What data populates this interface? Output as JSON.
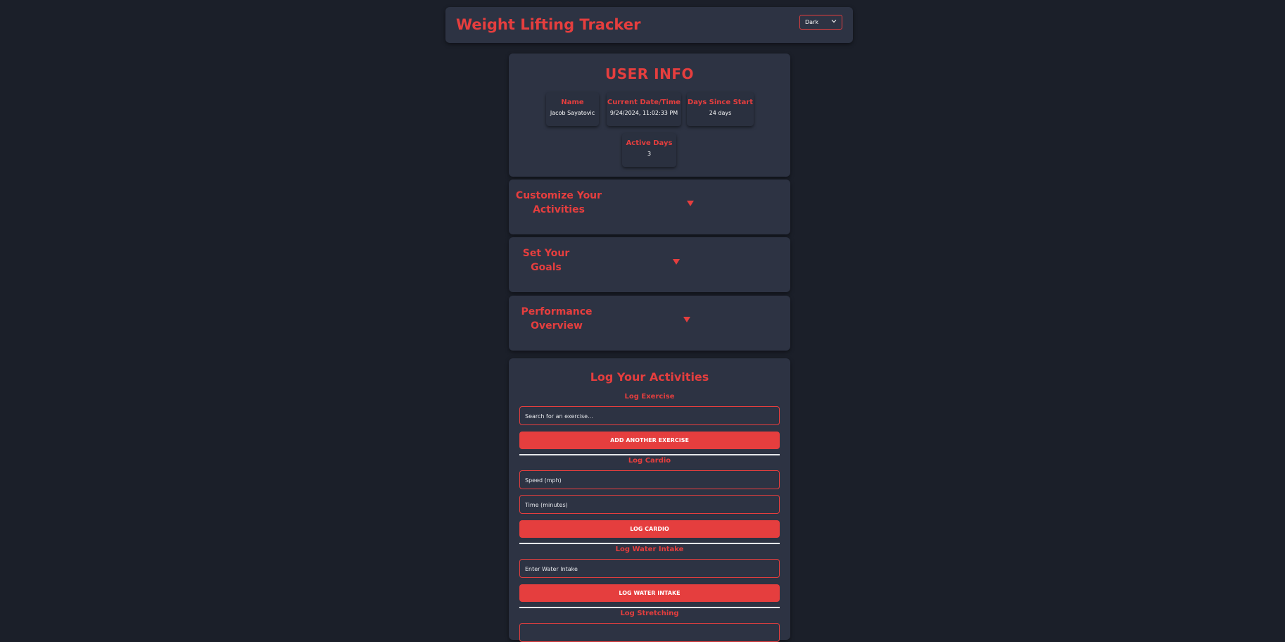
{
  "header": {
    "title": "Weight Lifting Tracker",
    "theme_selected": "Dark"
  },
  "user_info": {
    "heading": "USER INFO",
    "stats": [
      {
        "label": "Name",
        "value": "Jacob Sayatovic"
      },
      {
        "label": "Current Date/Time",
        "value": "9/24/2024, 11:02:33 PM"
      },
      {
        "label": "Days Since Start",
        "value": "24 days"
      },
      {
        "label": "Active Days",
        "value": "3"
      }
    ]
  },
  "sections": [
    {
      "title_line1": "Customize Your",
      "title_line2": "Activities"
    },
    {
      "title_line1": "Set Your",
      "title_line2": "Goals"
    },
    {
      "title_line1": "Performance",
      "title_line2": "Overview"
    }
  ],
  "log": {
    "heading": "Log Your Activities",
    "exercise": {
      "label": "Log Exercise",
      "search_placeholder": "Search for an exercise...",
      "button": "ADD ANOTHER EXERCISE"
    },
    "cardio": {
      "label": "Log Cardio",
      "speed_placeholder": "Speed (mph)",
      "time_placeholder": "Time (minutes)",
      "button": "LOG CARDIO"
    },
    "water": {
      "label": "Log Water Intake",
      "placeholder": "Enter Water Intake",
      "button": "LOG WATER INTAKE"
    },
    "stretching": {
      "label": "Log Stretching"
    }
  },
  "colors": {
    "accent": "#e53e3e",
    "background": "#1b1f29",
    "card": "#2d3343"
  },
  "icons": {
    "theme_chevron": "chevron-down-icon",
    "section_arrow": "caret-down-icon"
  }
}
